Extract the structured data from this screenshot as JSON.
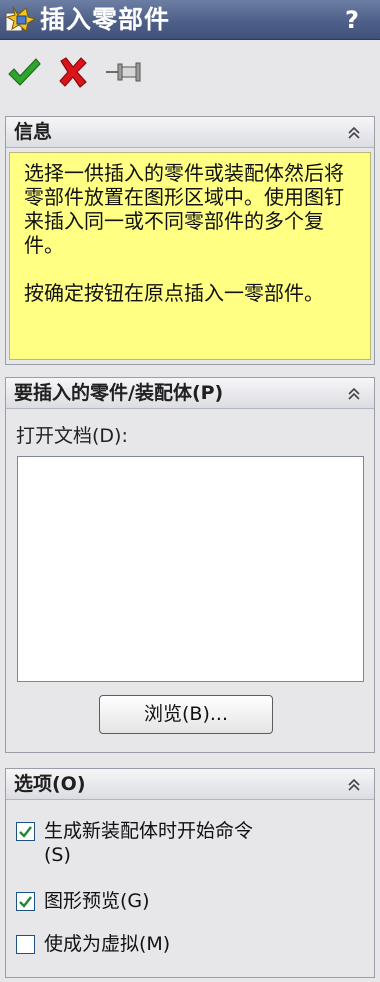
{
  "window": {
    "title": "插入零部件",
    "help_label": "?"
  },
  "toolbar": {
    "ok_icon": "green-checkmark-icon",
    "cancel_icon": "red-x-icon",
    "pin_icon": "pushpin-icon"
  },
  "info": {
    "header": "信息",
    "lines": [
      "选择一供插入的零件或装配体然后将零部件放置在图形区域中。使用图钉来插入同一或不同零部件的多个复件。",
      "按确定按钮在原点插入一零部件。"
    ],
    "background": "#ffff84"
  },
  "part": {
    "header": "要插入的零件/装配体(P)",
    "open_docs_label": "打开文档(D):",
    "browse_label": "浏览(B)..."
  },
  "options": {
    "header": "选项(O)",
    "items": [
      {
        "line1": "生成新装配体时开始命令",
        "line2": "(S)",
        "checked": true
      },
      {
        "label": "图形预览(G)",
        "checked": true
      },
      {
        "label": "使成为虚拟(M)",
        "checked": false
      }
    ]
  },
  "colors": {
    "title_bar": "#4e6089",
    "check_green": "#2fa52f",
    "cancel_red": "#d9141b"
  }
}
